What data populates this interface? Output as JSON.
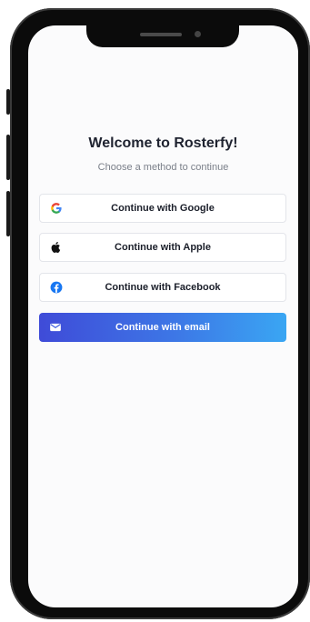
{
  "welcome": {
    "title": "Welcome to Rosterfy!",
    "subtitle": "Choose a method to continue"
  },
  "buttons": {
    "google": "Continue with Google",
    "apple": "Continue with Apple",
    "facebook": "Continue with Facebook",
    "email": "Continue with email"
  },
  "icons": {
    "google": "google-icon",
    "apple": "apple-icon",
    "facebook": "facebook-icon",
    "email": "mail-icon"
  },
  "colors": {
    "email_gradient_start": "#3f4bd8",
    "email_gradient_end": "#3aa6f3",
    "facebook_blue": "#1877f2"
  }
}
